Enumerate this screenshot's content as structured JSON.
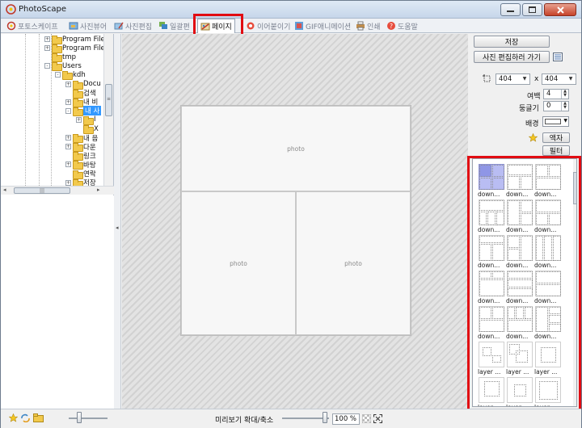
{
  "window": {
    "title": "PhotoScape"
  },
  "tabs": [
    {
      "label": "포토스케이프",
      "icon": "photoscape-icon"
    },
    {
      "label": "사진뷰어",
      "icon": "viewer-icon"
    },
    {
      "label": "사진편집",
      "icon": "editor-icon"
    },
    {
      "label": "일괄편",
      "icon": "batch-icon"
    },
    {
      "label": "페이지",
      "icon": "page-icon",
      "active": true
    },
    {
      "label": "이어붙이기",
      "icon": "combine-icon"
    },
    {
      "label": "GIF애니메이션",
      "icon": "gif-icon"
    },
    {
      "label": "인쇄",
      "icon": "print-icon"
    },
    {
      "label": "도움말",
      "icon": "help-icon"
    }
  ],
  "tree": [
    {
      "label": "Program File",
      "depth": 0,
      "exp": "+"
    },
    {
      "label": "Program File",
      "depth": 0,
      "exp": "+"
    },
    {
      "label": "tmp",
      "depth": 0,
      "exp": ""
    },
    {
      "label": "Users",
      "depth": 0,
      "exp": "-"
    },
    {
      "label": "kdh",
      "depth": 1,
      "exp": "-"
    },
    {
      "label": "Docu",
      "depth": 2,
      "exp": "+"
    },
    {
      "label": "검색",
      "depth": 2,
      "exp": ""
    },
    {
      "label": "내 비",
      "depth": 2,
      "exp": "+"
    },
    {
      "label": "내 사",
      "depth": 2,
      "exp": "-",
      "selected": true
    },
    {
      "label": "I",
      "depth": 3,
      "exp": "+"
    },
    {
      "label": "X",
      "depth": 3,
      "exp": ""
    },
    {
      "label": "내 음",
      "depth": 2,
      "exp": "+"
    },
    {
      "label": "다운",
      "depth": 2,
      "exp": "+"
    },
    {
      "label": "링크",
      "depth": 2,
      "exp": ""
    },
    {
      "label": "바탕",
      "depth": 2,
      "exp": "+"
    },
    {
      "label": "연락",
      "depth": 2,
      "exp": ""
    },
    {
      "label": "저장",
      "depth": 2,
      "exp": "+"
    }
  ],
  "canvas": {
    "cells": [
      "photo",
      "photo",
      "photo"
    ]
  },
  "right": {
    "save": "저장",
    "goto_editor": "사진 편집하러 가기",
    "width": "404",
    "x": "x",
    "height": "404",
    "margin_label": "여백",
    "margin_value": "4",
    "round_label": "둥글기",
    "round_value": "0",
    "bg_label": "배경",
    "frame_button": "액자",
    "filter_button": "필터"
  },
  "layouts": [
    "down...",
    "down...",
    "down...",
    "down...",
    "down...",
    "down...",
    "down...",
    "down...",
    "down...",
    "down...",
    "down...",
    "down...",
    "down...",
    "down...",
    "down...",
    "layer ...",
    "layer ...",
    "layer ...",
    "layer ...",
    "layer ...",
    "layer ..."
  ],
  "status": {
    "preview_label": "미리보기 확대/축소",
    "zoom_value": "100 %"
  }
}
